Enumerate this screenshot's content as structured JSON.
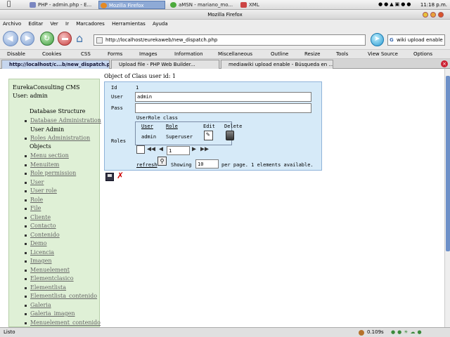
{
  "taskbar": {
    "tasks": [
      {
        "label": "PHP - admin.php - E..."
      },
      {
        "label": "Mozilla Firefox"
      },
      {
        "label": "aMSN - mariano_mo..."
      },
      {
        "label": "XML"
      }
    ],
    "clock": "11:18 p.m."
  },
  "window": {
    "title": "Mozilla Firefox"
  },
  "menu": [
    "Archivo",
    "Editar",
    "Ver",
    "Ir",
    "Marcadores",
    "Herramientas",
    "Ayuda"
  ],
  "nav": {
    "url": "http://localhost/eurekaweb/new_dispatch.php",
    "search_value": "wiki upload enable"
  },
  "devbar": [
    "Disable",
    "Cookies",
    "CSS",
    "Forms",
    "Images",
    "Information",
    "Miscellaneous",
    "Outline",
    "Resize",
    "Tools",
    "View Source",
    "Options"
  ],
  "tabs": [
    {
      "label": "http://localhost/c...b/new_dispatch.php"
    },
    {
      "label": "Upload file - PHP Web Builder..."
    },
    {
      "label": "mediawiki upload enable - Búsqueda en ..."
    }
  ],
  "sidebar": {
    "title": "EurekaConsulting CMS",
    "user": "User: admin",
    "db_header": "Database Structure",
    "db_items": [
      "Database Administration",
      "User Admin",
      "Roles Administration"
    ],
    "objects_header": "Objects",
    "objects": [
      "Menu section",
      "Menuitem",
      "Role permission",
      "User",
      "User role",
      "Role",
      "File",
      "Cliente",
      "Contacto",
      "Contenido",
      "Demo",
      "Licencia",
      "Imagen",
      "Menuelement",
      "Elementclasico",
      "Elementlista",
      "Elementlista_contenido",
      "Galeria",
      "Galeria_imagen",
      "Menuelement_contenido"
    ]
  },
  "form": {
    "title": "Object of Class user id: 1",
    "id_label": "Id",
    "id_value": "1",
    "user_label": "User",
    "user_value": "admin",
    "pass_label": "Pass",
    "pass_value": "",
    "roles_label": "Roles",
    "userrole_title": "UserRole class",
    "col_user": "User",
    "col_role": "Role",
    "col_edit": "Edit",
    "col_delete": "Delete",
    "row_user": "admin",
    "row_role": "Superuser",
    "page_value": "1",
    "refresh": "refresh",
    "showing": "Showing",
    "per_page_value": "10",
    "per_page_text": "per page. 1 elements available."
  },
  "status": {
    "text": "Listo",
    "time": "0.109s"
  },
  "colors": {
    "sidebar_bg": "#dff0d6",
    "panel_bg": "#d6eaf8",
    "active_task": "#8eaad6"
  }
}
